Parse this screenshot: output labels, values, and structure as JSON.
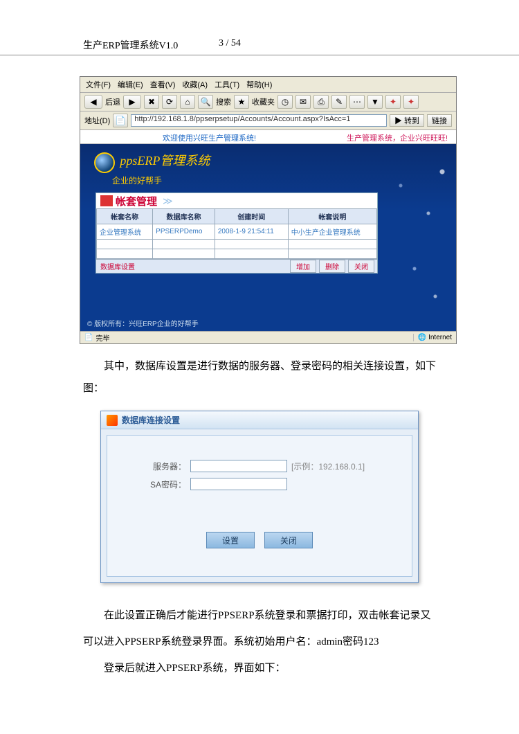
{
  "doc": {
    "header_title": "生产ERP管理系统V1.0",
    "page": "3 / 54"
  },
  "ie": {
    "menu": [
      "文件(F)",
      "编辑(E)",
      "查看(V)",
      "收藏(A)",
      "工具(T)",
      "帮助(H)"
    ],
    "toolbar": {
      "back": "后退",
      "search": "搜索",
      "favorites": "收藏夹"
    },
    "addr_label": "地址(D)",
    "url": "http://192.168.1.8/ppserpsetup/Accounts/Account.aspx?IsAcc=1",
    "goto": "转到",
    "links": "链接"
  },
  "banner": {
    "welcome": "欢迎使用兴旺生产管理系统!",
    "right": "生产管理系统，企业兴旺旺旺!"
  },
  "logo": {
    "line1": "ppsERP管理系统",
    "line2": "企业的好帮手"
  },
  "panel": {
    "title": "帐套管理",
    "cols": [
      "帐套名称",
      "数据库名称",
      "创建时间",
      "帐套说明"
    ],
    "row": {
      "c0": "企业管理系统",
      "c1": "PPSERPDemo",
      "c2": "2008-1-9 21:54:11",
      "c3": "中小生产企业管理系统"
    },
    "footer": {
      "dbset": "数据库设置",
      "add": "增加",
      "del": "删除",
      "close": "关闭"
    }
  },
  "copyright": "© 版权所有：兴旺ERP企业的好帮手",
  "status": {
    "done": "完毕",
    "zone": "Internet"
  },
  "text1": "其中，数据库设置是进行数据的服务器、登录密码的相关连接设置，如下图：",
  "dialog": {
    "title": "数据库连接设置",
    "server_label": "服务器：",
    "server_val": "",
    "server_hint": "[示例：192.168.0.1]",
    "sa_label": "SA密码：",
    "sa_val": "",
    "btn_set": "设置",
    "btn_close": "关闭"
  },
  "text2": "在此设置正确后才能进行PPSERP系统登录和票据打印，双击帐套记录又可以进入PPSERP系统登录界面。系统初始用户名：admin密码123",
  "text3": "登录后就进入PPSERP系统，界面如下："
}
